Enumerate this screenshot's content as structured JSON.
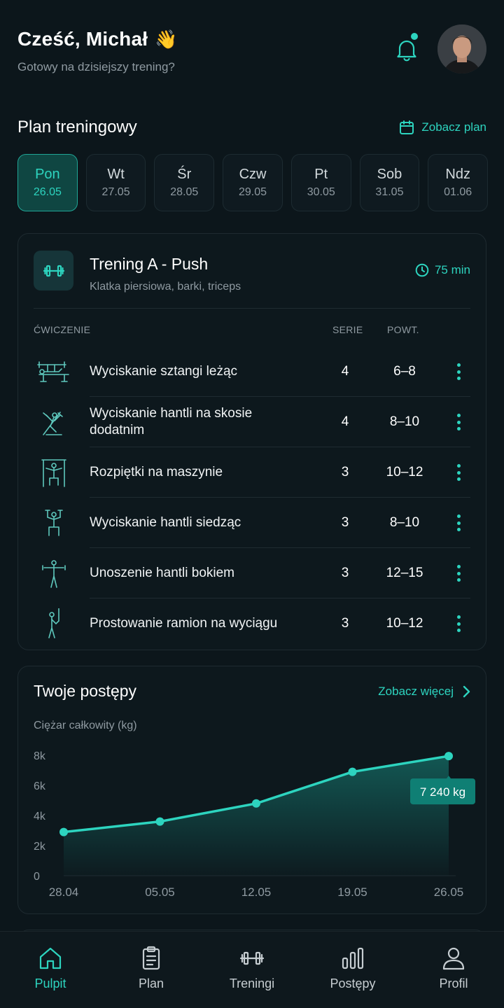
{
  "header": {
    "greeting": "Cześć, Michał",
    "wave_emoji": "👋",
    "subtitle": "Gotowy na dzisiejszy trening?"
  },
  "plan_section": {
    "title": "Plan treningowy",
    "link": "Zobacz plan"
  },
  "days": [
    {
      "name": "Pon",
      "date": "26.05",
      "active": true
    },
    {
      "name": "Wt",
      "date": "27.05",
      "active": false
    },
    {
      "name": "Śr",
      "date": "28.05",
      "active": false
    },
    {
      "name": "Czw",
      "date": "29.05",
      "active": false
    },
    {
      "name": "Pt",
      "date": "30.05",
      "active": false
    },
    {
      "name": "Sob",
      "date": "31.05",
      "active": false
    },
    {
      "name": "Ndz",
      "date": "01.06",
      "active": false
    }
  ],
  "workout": {
    "title": "Trening A - Push",
    "subtitle": "Klatka piersiowa, barki, triceps",
    "duration": "75 min",
    "columns": {
      "exercise": "ĆWICZENIE",
      "sets": "SERIE",
      "reps": "POWT."
    },
    "exercises": [
      {
        "name": "Wyciskanie sztangi leżąc",
        "sets": "4",
        "reps": "6–8",
        "icon": "bench-press-icon"
      },
      {
        "name": "Wyciskanie hantli na skosie dodatnim",
        "sets": "4",
        "reps": "8–10",
        "icon": "incline-press-icon"
      },
      {
        "name": "Rozpiętki na maszynie",
        "sets": "3",
        "reps": "10–12",
        "icon": "machine-fly-icon"
      },
      {
        "name": "Wyciskanie hantli siedząc",
        "sets": "3",
        "reps": "8–10",
        "icon": "seated-press-icon"
      },
      {
        "name": "Unoszenie hantli bokiem",
        "sets": "3",
        "reps": "12–15",
        "icon": "lateral-raise-icon"
      },
      {
        "name": "Prostowanie ramion na wyciągu",
        "sets": "3",
        "reps": "10–12",
        "icon": "triceps-pushdown-icon"
      }
    ]
  },
  "progress": {
    "title": "Twoje postępy",
    "link": "Zobacz więcej",
    "subtitle": "Ciężar całkowity (kg)",
    "tooltip": "7 240 kg"
  },
  "chart_data": {
    "type": "area",
    "x": [
      "28.04",
      "05.05",
      "12.05",
      "19.05",
      "26.05"
    ],
    "values": [
      2900,
      3600,
      4800,
      6900,
      7950
    ],
    "yticks": [
      "0",
      "2k",
      "4k",
      "6k",
      "8k"
    ],
    "ylim": [
      0,
      8000
    ],
    "ylabel": "Ciężar całkowity (kg)",
    "color": "#2dd4bf"
  },
  "nav": [
    {
      "label": "Pulpit",
      "icon": "home-icon",
      "active": true
    },
    {
      "label": "Plan",
      "icon": "clipboard-icon",
      "active": false
    },
    {
      "label": "Treningi",
      "icon": "dumbbell-icon",
      "active": false
    },
    {
      "label": "Postępy",
      "icon": "bar-chart-icon",
      "active": false
    },
    {
      "label": "Profil",
      "icon": "user-icon",
      "active": false
    }
  ],
  "colors": {
    "accent": "#2dd4bf",
    "background": "#0c161b"
  }
}
